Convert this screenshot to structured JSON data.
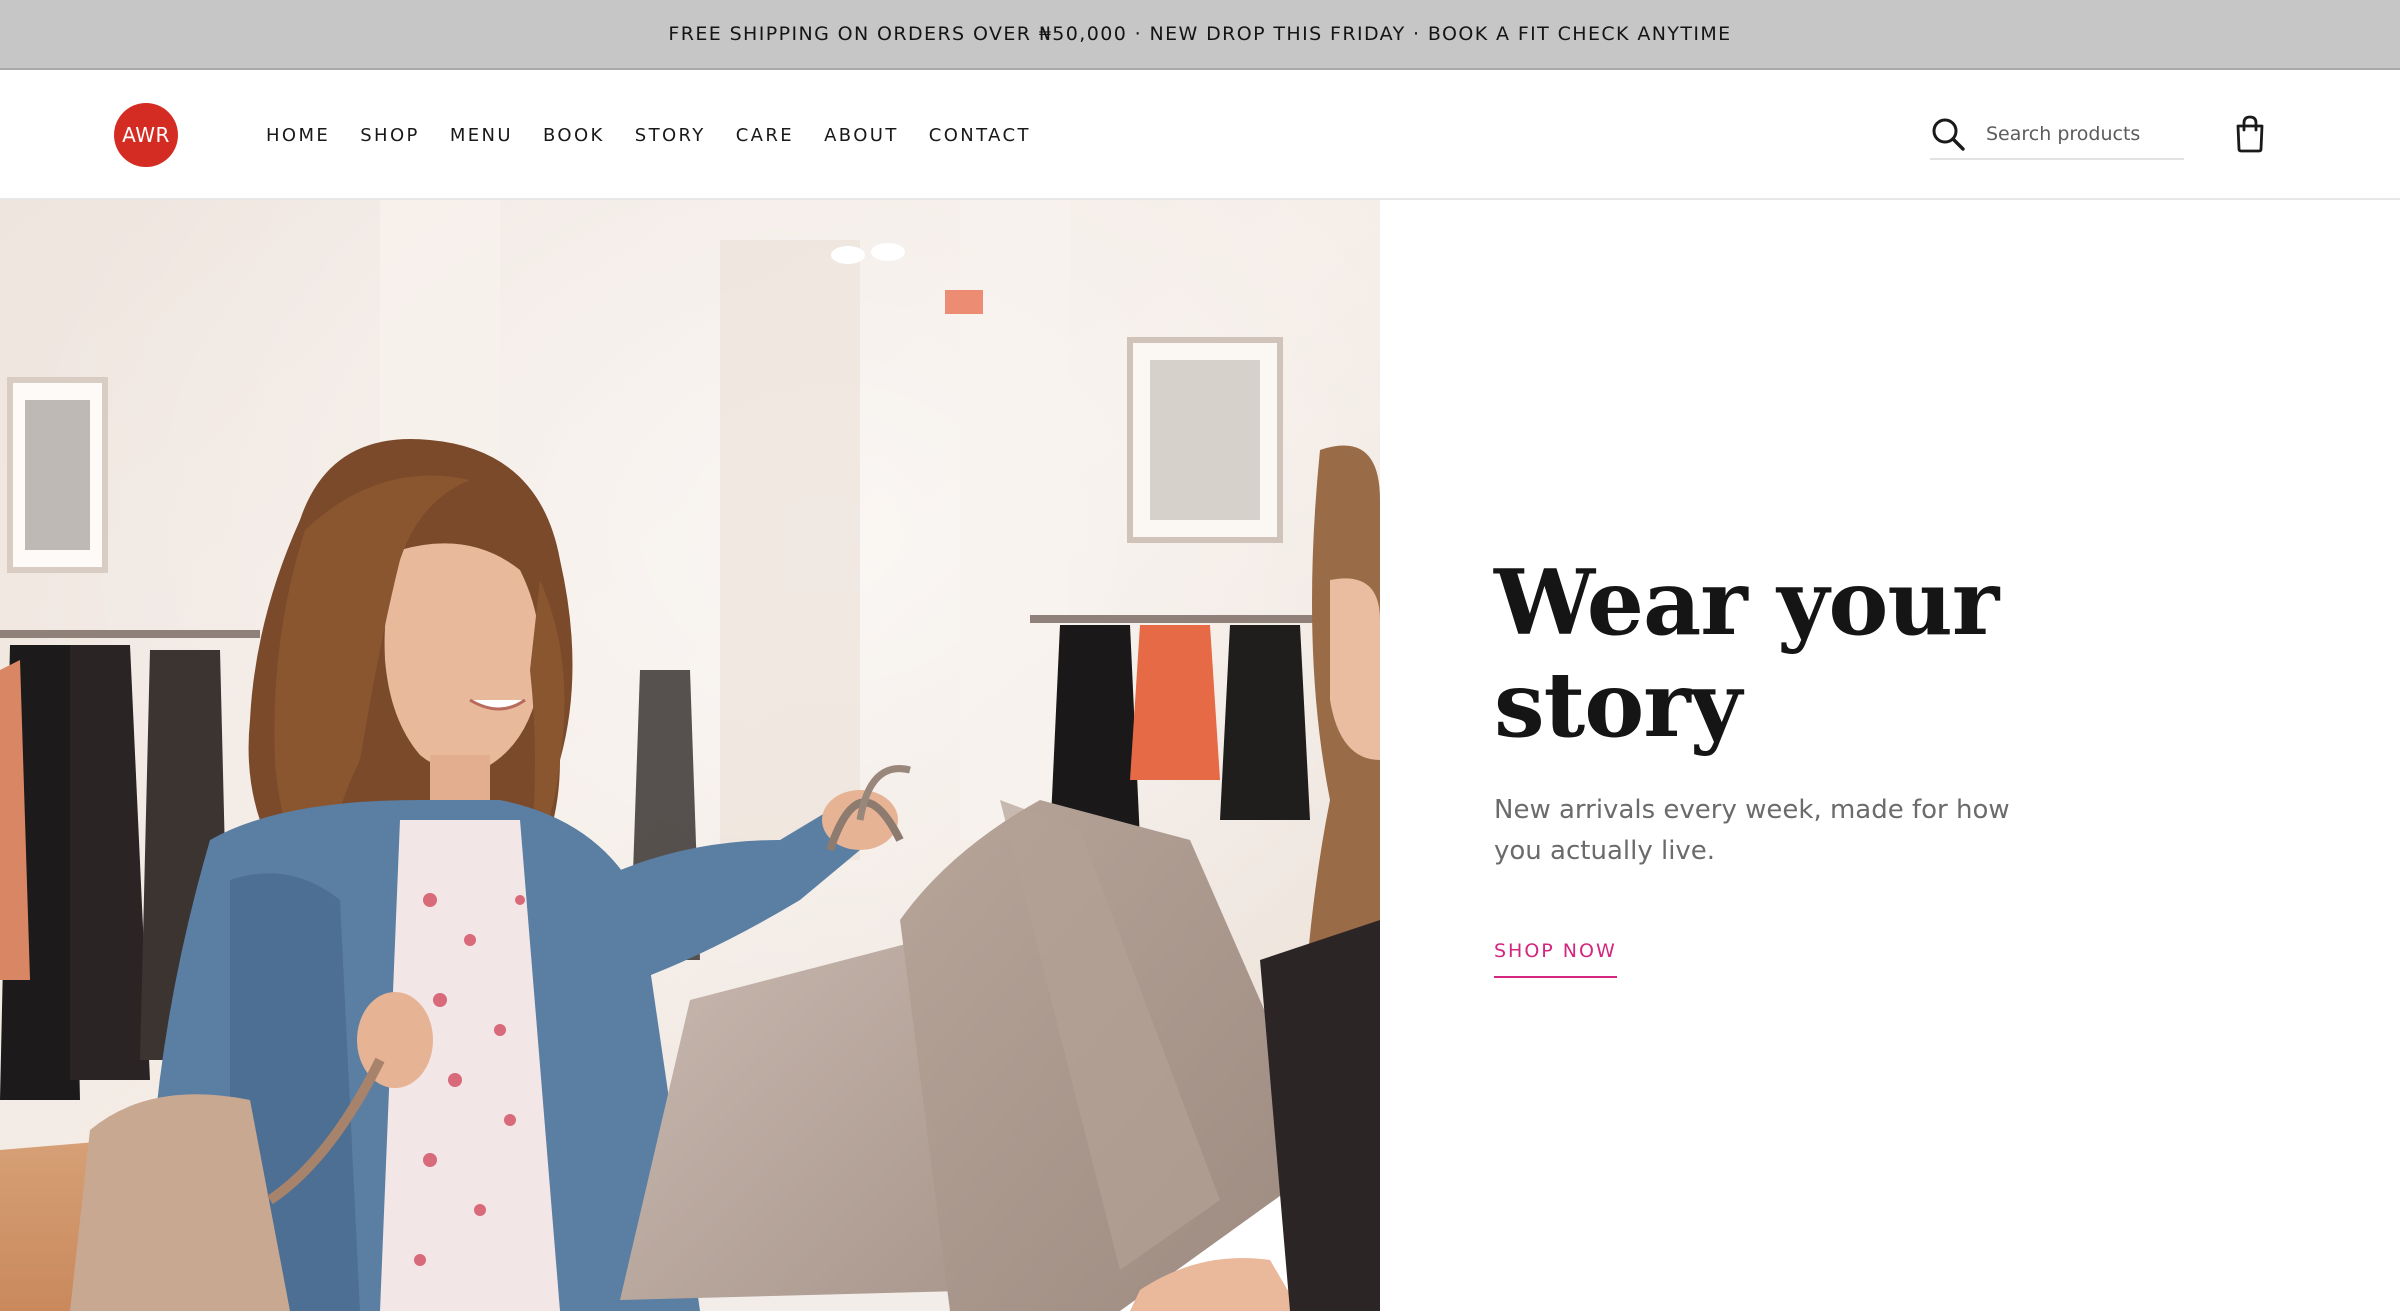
{
  "announcement": {
    "text": "FREE SHIPPING ON ORDERS OVER ₦50,000 · NEW DROP THIS FRIDAY · BOOK A FIT CHECK ANYTIME"
  },
  "header": {
    "logo_text": "AWR",
    "nav": [
      "HOME",
      "SHOP",
      "MENU",
      "BOOK",
      "STORY",
      "CARE",
      "ABOUT",
      "CONTACT"
    ],
    "search": {
      "placeholder": "Search products",
      "icon": "search-icon"
    },
    "cart_icon": "shopping-bag-icon"
  },
  "hero": {
    "image_alt": "Smiling woman receiving shopping bags in a clothing store",
    "title_line1": "Wear your",
    "title_line2": "story",
    "subtitle": "New arrivals every week, made for how you actually live.",
    "cta_label": "SHOP NOW"
  },
  "colors": {
    "announcement_bg": "#c6c6c6",
    "logo_red": "#d42c22",
    "cta_pink": "#d4267e",
    "text_dark": "#151515",
    "text_muted": "#6b6b6b"
  }
}
